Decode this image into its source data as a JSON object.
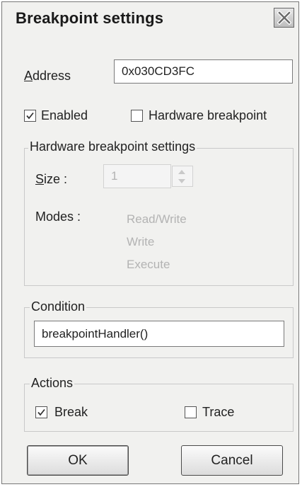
{
  "dialog": {
    "title": "Breakpoint settings"
  },
  "address": {
    "label": "Address",
    "value": "0x030CD3FC"
  },
  "enabled": {
    "label": "Enabled",
    "checked": true
  },
  "hardware": {
    "label": "Hardware breakpoint",
    "checked": false
  },
  "hw_settings": {
    "title": "Hardware breakpoint settings",
    "size_label": "Size :",
    "size_value": "1",
    "modes_label": "Modes :",
    "modes": [
      "Read/Write",
      "Write",
      "Execute"
    ]
  },
  "condition": {
    "title": "Condition",
    "value": "breakpointHandler()"
  },
  "actions": {
    "title": "Actions",
    "break": {
      "label": "Break",
      "checked": true
    },
    "trace": {
      "label": "Trace",
      "checked": false
    }
  },
  "buttons": {
    "ok": "OK",
    "cancel": "Cancel"
  }
}
